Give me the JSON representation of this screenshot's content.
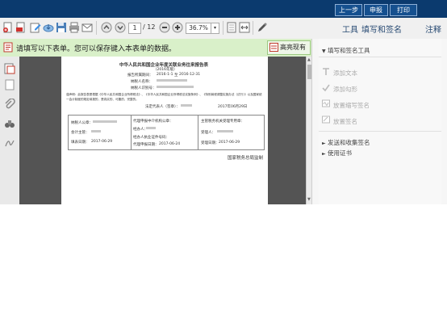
{
  "header": {
    "buttons": [
      {
        "label": "上一步"
      },
      {
        "label": "申报"
      },
      {
        "label": "打印"
      }
    ]
  },
  "toolbar": {
    "page_current": "1",
    "page_total": "/ 12",
    "zoom": "36.7%",
    "right_tabs": [
      {
        "label": "工具"
      },
      {
        "label": "填写和签名"
      },
      {
        "label": "注释"
      }
    ]
  },
  "notice": {
    "text": "请填写以下表单。您可以保存键入本表单的数据。",
    "highlight_button": "高亮现有域"
  },
  "right_panel": {
    "section_title": "填写和签名工具",
    "tools": [
      {
        "label": "添加文本",
        "icon": "text-tool-icon"
      },
      {
        "label": "添加勾形",
        "icon": "checkmark-icon"
      },
      {
        "label": "放置缩写签名",
        "icon": "initials-icon"
      },
      {
        "label": "放置签名",
        "icon": "signature-icon"
      }
    ],
    "collapsed_sections": [
      {
        "label": "发送和收集签名"
      },
      {
        "label": "使用证书"
      }
    ]
  },
  "document": {
    "title": "中华人民共和国企业年度关联业务往来报告表",
    "year": "（2016年版）",
    "period_label": "报告所属期间：",
    "period_start": "2016-1-1",
    "period_to": "至",
    "period_end": "2016-12-31",
    "taxpayer_name_label": "纳税人名称：",
    "taxpayer_id_label": "纳税人识别号：",
    "declaration_line1": "谨声明：此报告表是根据《中华人民共和国企业所得税法》、《中华人民共和国企业所得税法实施条例》、《特别纳税调整实施办法（试行）》以及国家统一会计制度的规定填报的，是真实的、可靠的、完整的。",
    "legal_rep_label": "法定代表人（签章）：",
    "sign_date": "2017年06月29日",
    "table": {
      "left": [
        "纳税人公章：",
        "会计主管：",
        "填表日期："
      ],
      "left_date": "2017-06-29",
      "middle": [
        "代理申报中介机构公章：",
        "经办人：",
        "经办人执业证件号码：",
        "代理申报日期："
      ],
      "middle_date": "2017-06-24",
      "right": [
        "主管税务机关受理专用章：",
        "受理人：",
        "受理日期："
      ],
      "right_date": "2017-06-29"
    },
    "footer": "国家税务总局监制"
  }
}
